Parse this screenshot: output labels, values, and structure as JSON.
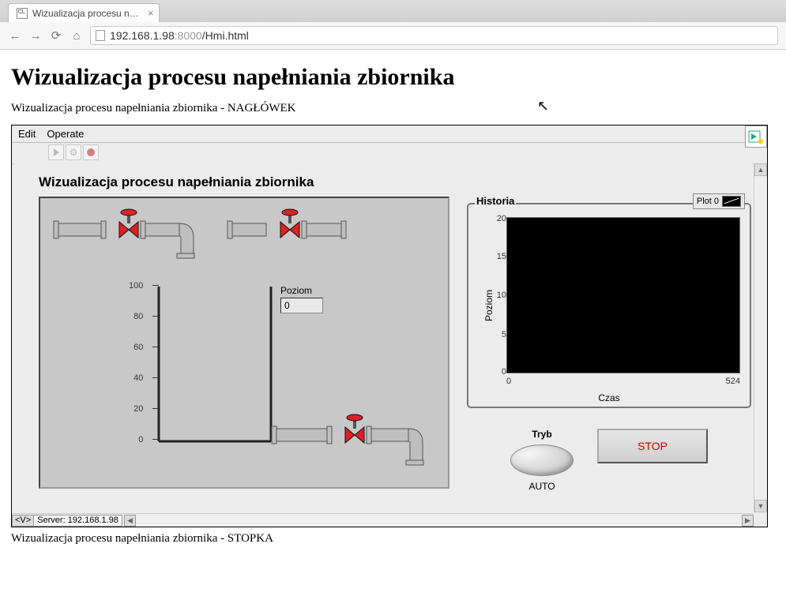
{
  "browser": {
    "tab_title": "Wizualizacja procesu nape",
    "url_host": "192.168.1.98",
    "url_port": ":8000",
    "url_path": "/Hmi.html"
  },
  "page": {
    "h1": "Wizualizacja procesu napełniania zbiornika",
    "subheader": "Wizualizacja procesu napełniania zbiornika - NAGŁÓWEK",
    "footer": "Wizualizacja procesu napełniania zbiornika - STOPKA"
  },
  "hmi": {
    "menu": {
      "edit": "Edit",
      "operate": "Operate"
    },
    "panel_title": "Wizualizacja procesu napełniania zbiornika",
    "level": {
      "label": "Poziom",
      "value": "0"
    },
    "tank_scale": [
      "100",
      "80",
      "60",
      "40",
      "20",
      "0"
    ],
    "history": {
      "title": "Historia",
      "legend": "Plot 0",
      "y_label": "Poziom",
      "x_label": "Czas",
      "y_ticks": [
        "20",
        "15",
        "10",
        "5",
        "0"
      ],
      "x_ticks": [
        "0",
        "524"
      ]
    },
    "mode": {
      "title": "Tryb",
      "value": "AUTO"
    },
    "stop": "STOP",
    "status": {
      "prefix": "<V>",
      "text": "Server: 192.168.1.98"
    }
  },
  "chart_data": {
    "type": "line",
    "title": "Historia",
    "xlabel": "Czas",
    "ylabel": "Poziom",
    "xlim": [
      0,
      524
    ],
    "ylim": [
      0,
      20
    ],
    "series": [
      {
        "name": "Plot 0",
        "x": [],
        "y": []
      }
    ]
  }
}
